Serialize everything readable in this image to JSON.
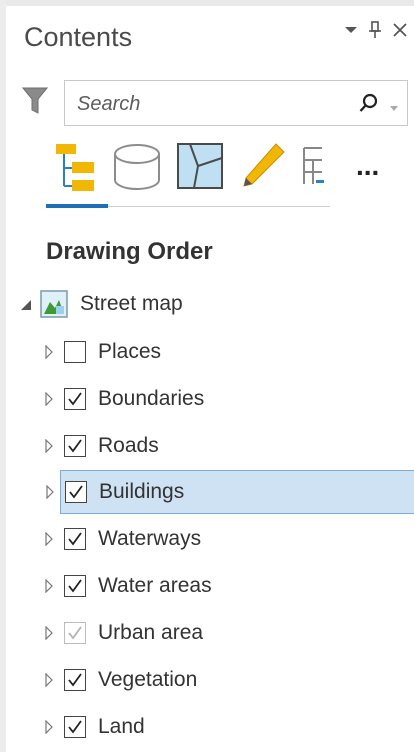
{
  "pane": {
    "title": "Contents"
  },
  "search": {
    "placeholder": "Search"
  },
  "toolbar": {
    "more_label": "..."
  },
  "section": {
    "heading": "Drawing Order"
  },
  "tree": {
    "root": {
      "label": "Street map",
      "expanded": true
    },
    "layers": [
      {
        "label": "Places",
        "checked": false
      },
      {
        "label": "Boundaries",
        "checked": true
      },
      {
        "label": "Roads",
        "checked": true
      },
      {
        "label": "Buildings",
        "checked": true,
        "selected": true
      },
      {
        "label": "Waterways",
        "checked": true
      },
      {
        "label": "Water areas",
        "checked": true
      },
      {
        "label": "Urban area",
        "checked": true,
        "faded": true
      },
      {
        "label": "Vegetation",
        "checked": true
      },
      {
        "label": "Land",
        "checked": true
      }
    ]
  },
  "colors": {
    "accent": "#1f6fb7",
    "selection": "#cfe2f3",
    "selection_border": "#7aaed8"
  }
}
